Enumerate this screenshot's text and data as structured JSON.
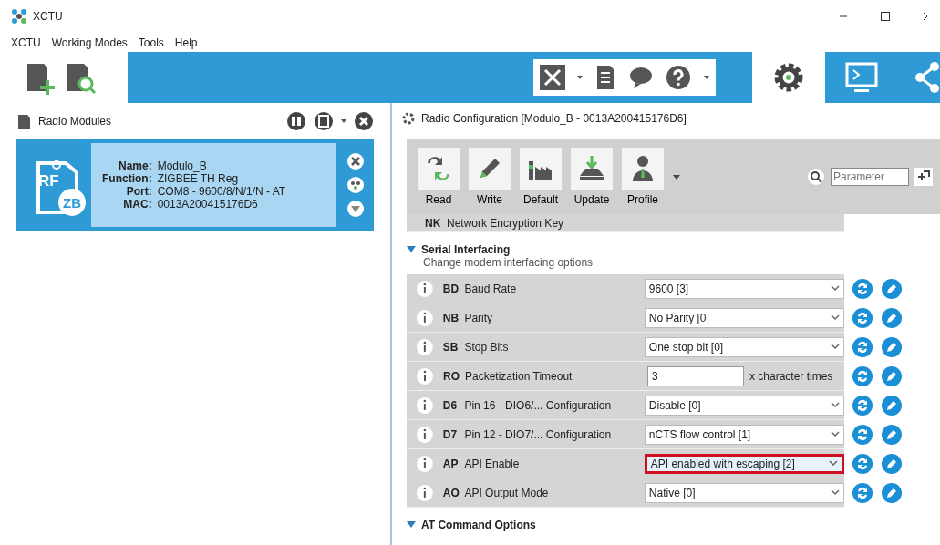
{
  "window": {
    "title": "XCTU"
  },
  "menu": [
    "XCTU",
    "Working Modes",
    "Tools",
    "Help"
  ],
  "modules_panel": {
    "title": "Radio Modules",
    "module": {
      "selected": true,
      "badge": "ZB",
      "badge_top": "RF",
      "fields": [
        {
          "label": "Name:",
          "value": "Modulo_B"
        },
        {
          "label": "Function:",
          "value": "ZIGBEE TH Reg"
        },
        {
          "label": "Port:",
          "value": "COM8 - 9600/8/N/1/N - AT"
        },
        {
          "label": "MAC:",
          "value": "0013A200415176D6"
        }
      ]
    }
  },
  "config_panel": {
    "title": "Radio Configuration [Modulo_B - 0013A200415176D6]",
    "actions": [
      "Read",
      "Write",
      "Default",
      "Update",
      "Profile"
    ],
    "search": {
      "placeholder": "Parameter"
    },
    "top_row": {
      "code": "NK",
      "name": "Network Encryption Key"
    },
    "section": {
      "title": "Serial Interfacing",
      "subtitle": "Change modem interfacing options",
      "expanded": true
    },
    "rows": [
      {
        "kind": "select",
        "code": "BD",
        "name": "Baud Rate",
        "value": "9600 [3]",
        "highlighted": false
      },
      {
        "kind": "select",
        "code": "NB",
        "name": "Parity",
        "value": "No Parity [0]",
        "highlighted": false
      },
      {
        "kind": "select",
        "code": "SB",
        "name": "Stop Bits",
        "value": "One stop bit [0]",
        "highlighted": false
      },
      {
        "kind": "input",
        "code": "RO",
        "name": "Packetization Timeout",
        "value": "3",
        "suffix": "x character times",
        "highlighted": false
      },
      {
        "kind": "select",
        "code": "D6",
        "name": "Pin 16 - DIO6/... Configuration",
        "value": "Disable [0]",
        "highlighted": false
      },
      {
        "kind": "select",
        "code": "D7",
        "name": "Pin 12 - DIO7/... Configuration",
        "value": "nCTS flow control [1]",
        "highlighted": false
      },
      {
        "kind": "select",
        "code": "AP",
        "name": "API Enable",
        "value": "API enabled with escaping [2]",
        "highlighted": true
      },
      {
        "kind": "select",
        "code": "AO",
        "name": "API Output Mode",
        "value": "Native [0]",
        "highlighted": false
      }
    ],
    "next_section": {
      "title": "AT Command Options",
      "expanded": true
    }
  }
}
